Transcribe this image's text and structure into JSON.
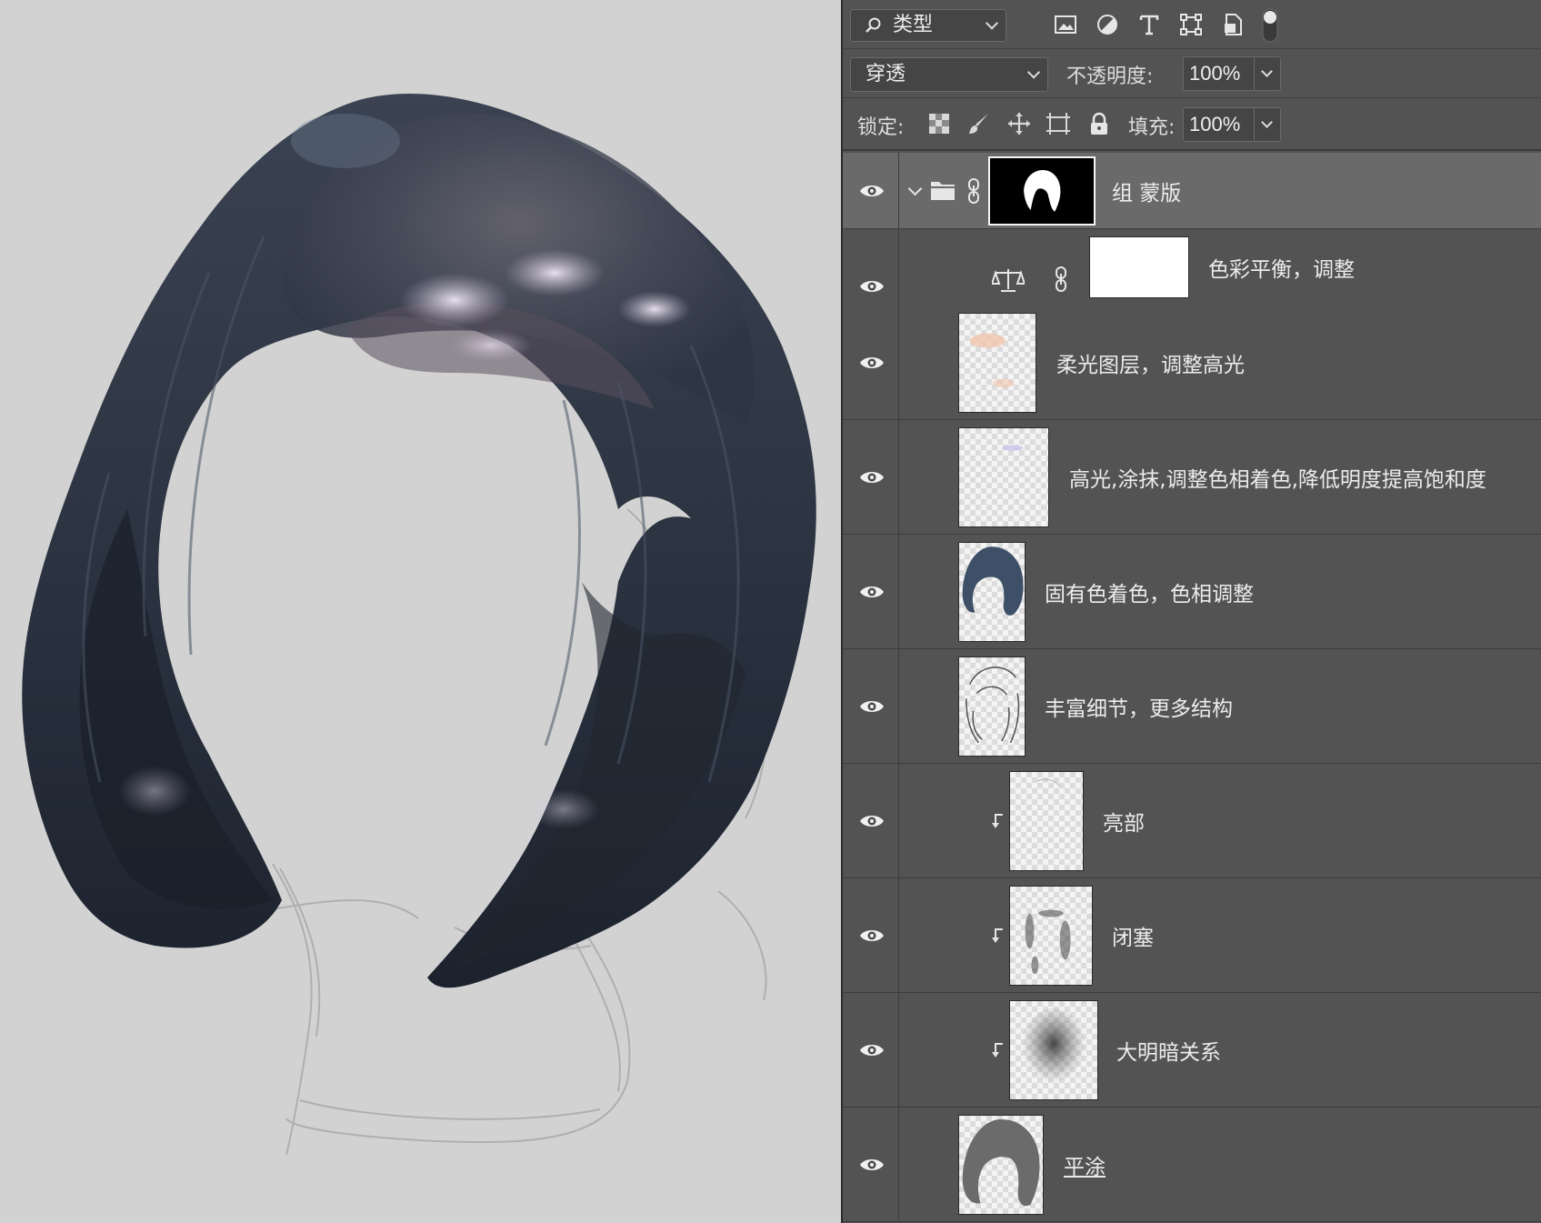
{
  "panel": {
    "filter_kind": "类型",
    "filter_icons": [
      "image-filter-icon",
      "adjustment-filter-icon",
      "type-filter-icon",
      "shape-filter-icon",
      "smart-object-filter-icon",
      "filter-toggle-switch"
    ],
    "blend_mode": "穿透",
    "opacity_label": "不透明度:",
    "opacity_value": "100%",
    "lock_label": "锁定:",
    "lock_icons": [
      "lock-transparent-pixels-icon",
      "lock-image-pixels-icon",
      "lock-position-icon",
      "lock-artboard-icon",
      "lock-all-icon"
    ],
    "fill_label": "填充:",
    "fill_value": "100%"
  },
  "layers": [
    {
      "name": "组 蒙版",
      "type": "group",
      "visible": true,
      "expanded": true,
      "selected": true,
      "mask": true
    },
    {
      "name": "色彩平衡，调整",
      "type": "adjustment",
      "adjustment": "color-balance",
      "visible": true
    },
    {
      "name": "柔光图层，调整高光",
      "type": "pixel",
      "visible": true
    },
    {
      "name": "高光,涂抹,调整色相着色,降低明度提高饱和度",
      "type": "pixel",
      "visible": true
    },
    {
      "name": "固有色着色，色相调整",
      "type": "pixel",
      "visible": true
    },
    {
      "name": "丰富细节，更多结构",
      "type": "pixel",
      "visible": true
    },
    {
      "name": "亮部",
      "type": "pixel",
      "visible": true,
      "clipped": true
    },
    {
      "name": "闭塞",
      "type": "pixel",
      "visible": true,
      "clipped": true
    },
    {
      "name": "大明暗关系",
      "type": "pixel",
      "visible": true,
      "clipped": true
    },
    {
      "name": "平涂",
      "type": "pixel",
      "visible": true,
      "underlined": true
    }
  ],
  "colors": {
    "panel_bg": "#535353",
    "selected_row": "#6a6a6a",
    "canvas_bg": "#d2d2d2",
    "hair_base": "#323a48",
    "hair_highlight": "#d8d0e0"
  }
}
